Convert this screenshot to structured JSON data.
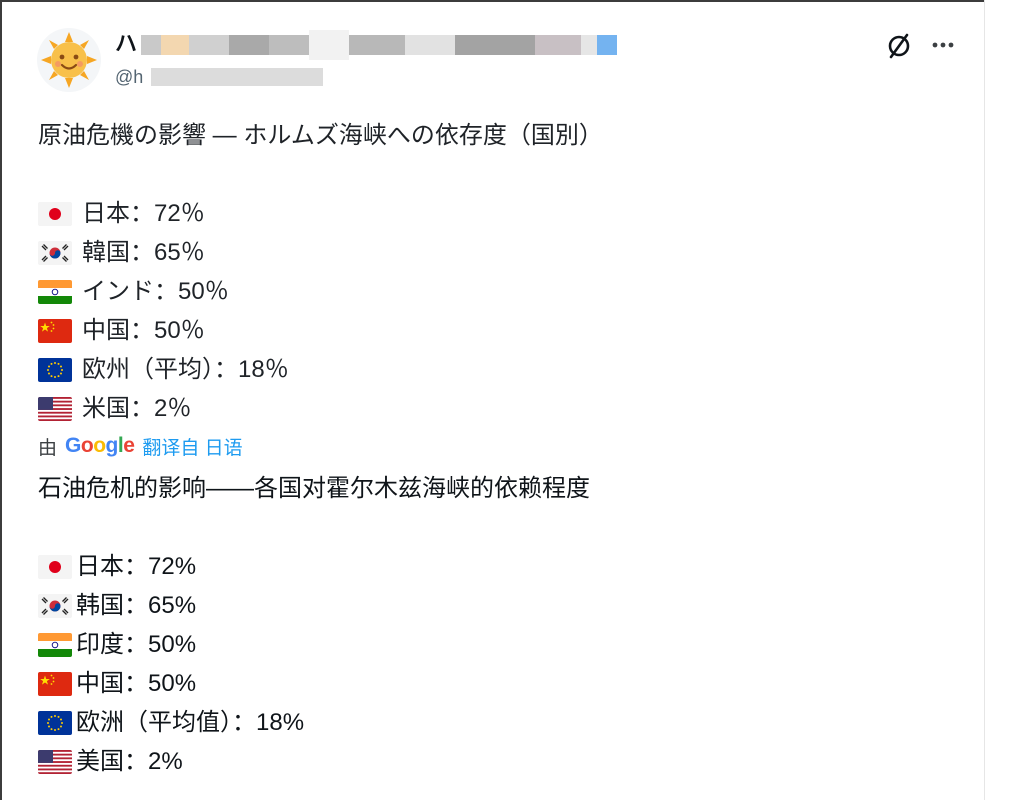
{
  "author": {
    "name_visible": "ハ",
    "handle_visible": "@h"
  },
  "actions": {
    "grok_icon": "slashed-circle-icon",
    "more_icon": "more-dots-icon",
    "more_label": "···"
  },
  "original": {
    "title": "原油危機の影響 — ホルムズ海峡への依存度（国別）",
    "items": [
      {
        "flag": "japan",
        "text": "日本：72％"
      },
      {
        "flag": "korea",
        "text": "韓国：65％"
      },
      {
        "flag": "india",
        "text": "インド：50％"
      },
      {
        "flag": "china",
        "text": "中国：50％"
      },
      {
        "flag": "eu",
        "text": "欧州（平均）：18％"
      },
      {
        "flag": "usa",
        "text": "米国：2％"
      }
    ]
  },
  "translation": {
    "prefix": "由",
    "provider": "Google",
    "link": "翻译自 日语",
    "title": "石油危机的影响——各国对霍尔木兹海峡的依赖程度",
    "items": [
      {
        "flag": "japan",
        "text": "日本：72%"
      },
      {
        "flag": "korea",
        "text": "韩国：65%"
      },
      {
        "flag": "india",
        "text": "印度：50%"
      },
      {
        "flag": "china",
        "text": "中国：50%"
      },
      {
        "flag": "eu",
        "text": "欧洲（平均值）：18%"
      },
      {
        "flag": "usa",
        "text": "美国：2%"
      }
    ]
  },
  "colors": {
    "link": "#1d9bf0",
    "text": "#0f1419",
    "muted": "#536471"
  }
}
